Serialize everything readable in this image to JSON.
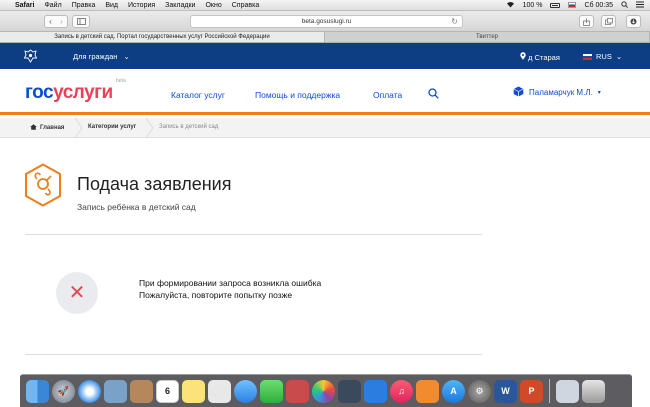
{
  "menubar": {
    "apple": "",
    "items": [
      "Safari",
      "Файл",
      "Правка",
      "Вид",
      "История",
      "Закладки",
      "Окно",
      "Справка"
    ],
    "battery": "100 %",
    "clock": "Сб 00:35"
  },
  "browser": {
    "url": "beta.gosuslugi.ru",
    "tabs": [
      {
        "label": "Запись в детский сад. Портал государственных услуг Российской Федерации",
        "active": true
      },
      {
        "label": "Твиттер",
        "active": false
      }
    ]
  },
  "topbar": {
    "for_citizens": "Для граждан",
    "region": "д Старая",
    "language": "RUS"
  },
  "header": {
    "logo_gos": "гос",
    "logo_uslugi": "услуги",
    "logo_beta": "beta",
    "nav": [
      "Каталог услуг",
      "Помощь и поддержка",
      "Оплата"
    ],
    "user_name": "Паламарчук М.Л."
  },
  "breadcrumbs": {
    "home": "Главная",
    "catalog": "Категории услуг",
    "current": "Запись в детский сад"
  },
  "page": {
    "title": "Подача заявления",
    "subtitle": "Запись ребёнка в детский сад"
  },
  "error": {
    "line1": "При формировании запроса возникла ошибка",
    "line2": "Пожалуйста, повторите попытку позже"
  },
  "dock": {
    "calendar_day": "6"
  },
  "colors": {
    "brand_blue": "#0d4cd3",
    "topbar_blue": "#0d3d83",
    "accent_orange": "#ee7d1c",
    "logo_red": "#ee3f58",
    "error_red": "#e34b52"
  }
}
